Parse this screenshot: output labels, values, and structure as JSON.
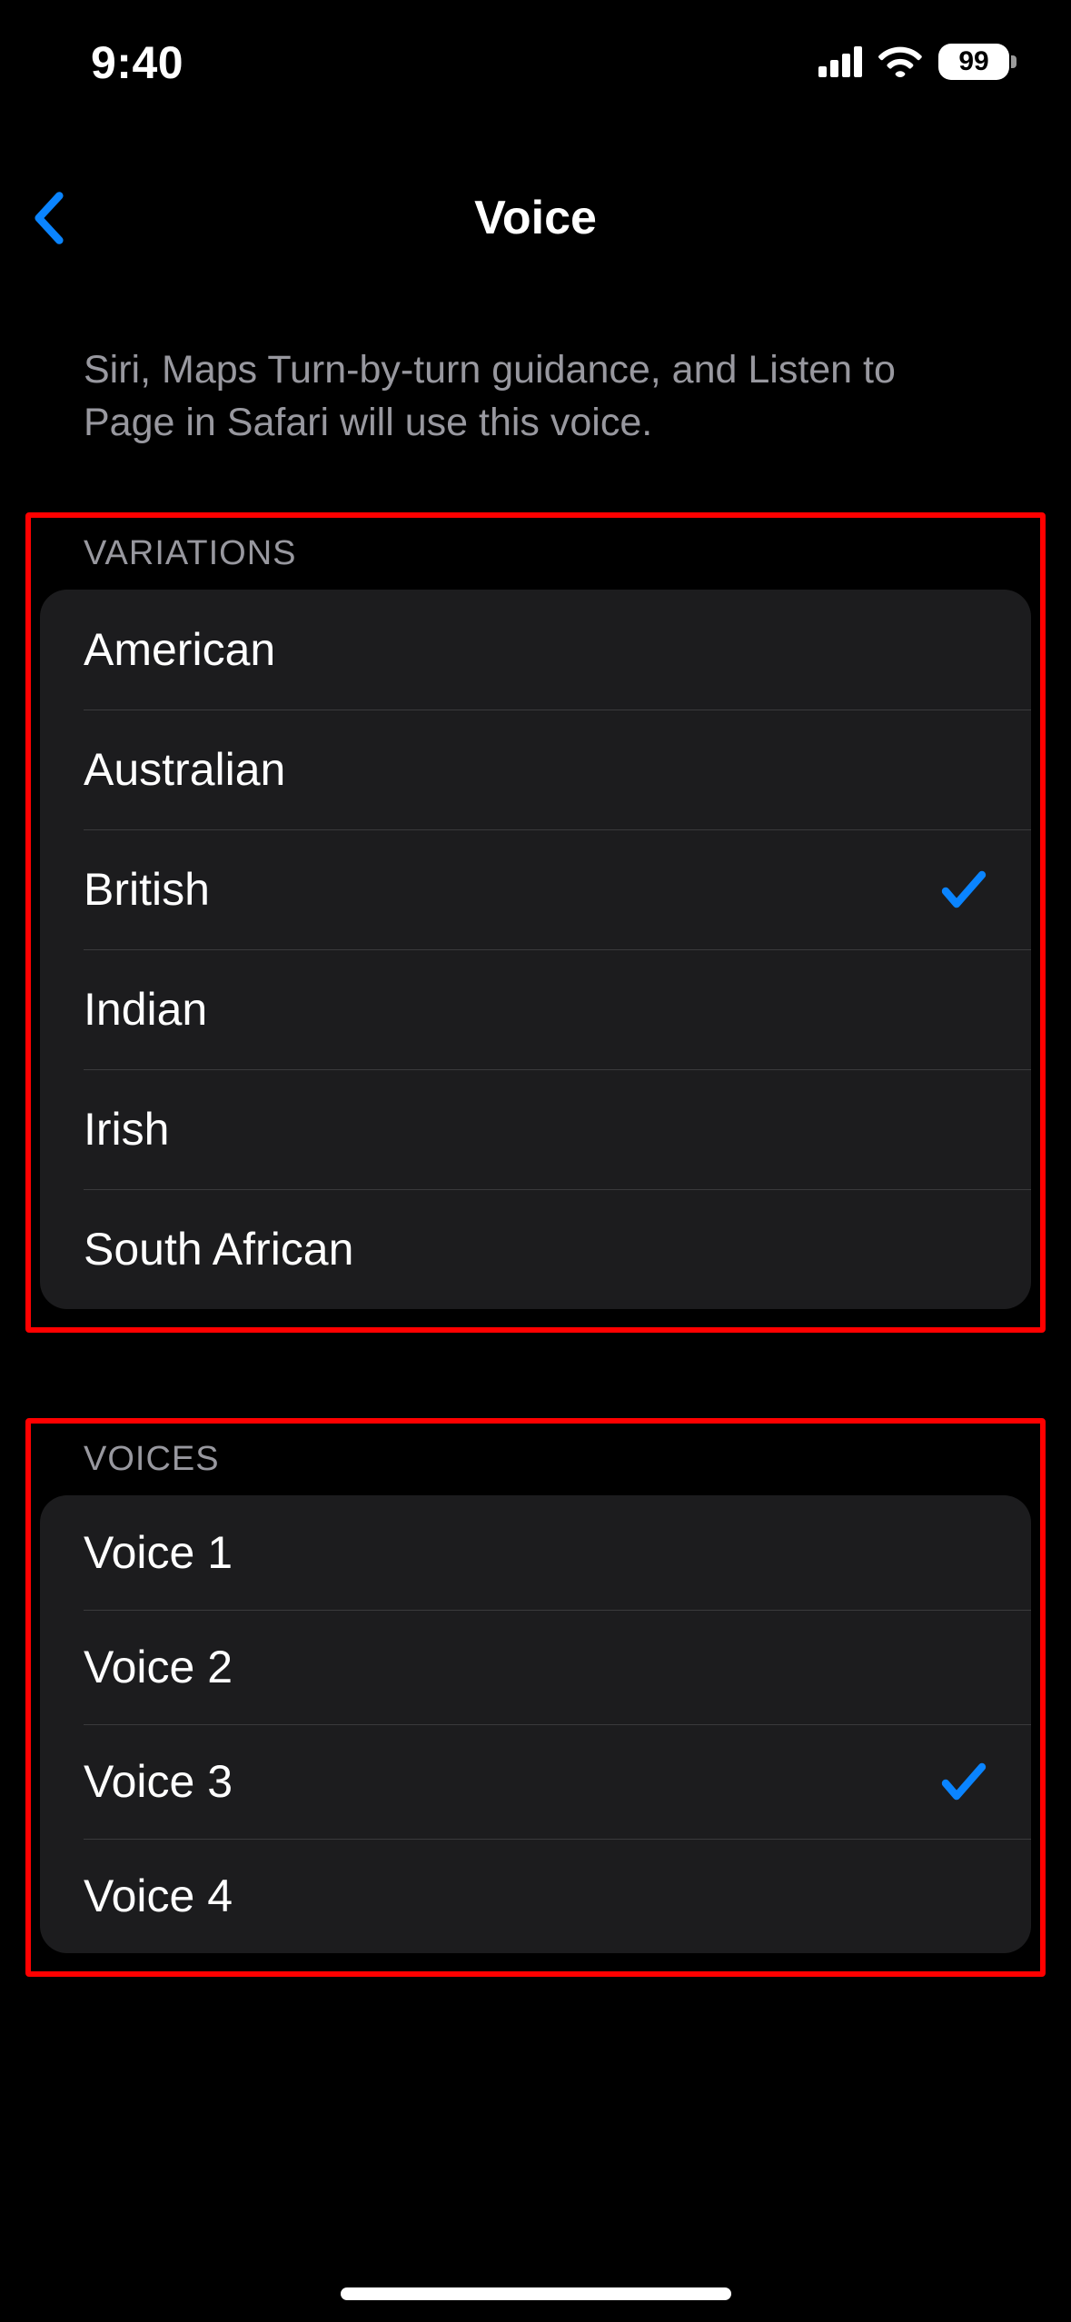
{
  "status": {
    "time": "9:40",
    "battery_percent": "99"
  },
  "nav": {
    "title": "Voice"
  },
  "description": "Siri, Maps Turn-by-turn guidance, and Listen to Page in Safari will use this voice.",
  "sections": {
    "variations": {
      "header": "VARIATIONS",
      "items": [
        {
          "label": "American",
          "selected": false
        },
        {
          "label": "Australian",
          "selected": false
        },
        {
          "label": "British",
          "selected": true
        },
        {
          "label": "Indian",
          "selected": false
        },
        {
          "label": "Irish",
          "selected": false
        },
        {
          "label": "South African",
          "selected": false
        }
      ]
    },
    "voices": {
      "header": "VOICES",
      "items": [
        {
          "label": "Voice 1",
          "selected": false
        },
        {
          "label": "Voice 2",
          "selected": false
        },
        {
          "label": "Voice 3",
          "selected": true
        },
        {
          "label": "Voice 4",
          "selected": false
        }
      ]
    }
  },
  "colors": {
    "accent": "#0a84ff",
    "highlight": "#ff0000"
  }
}
